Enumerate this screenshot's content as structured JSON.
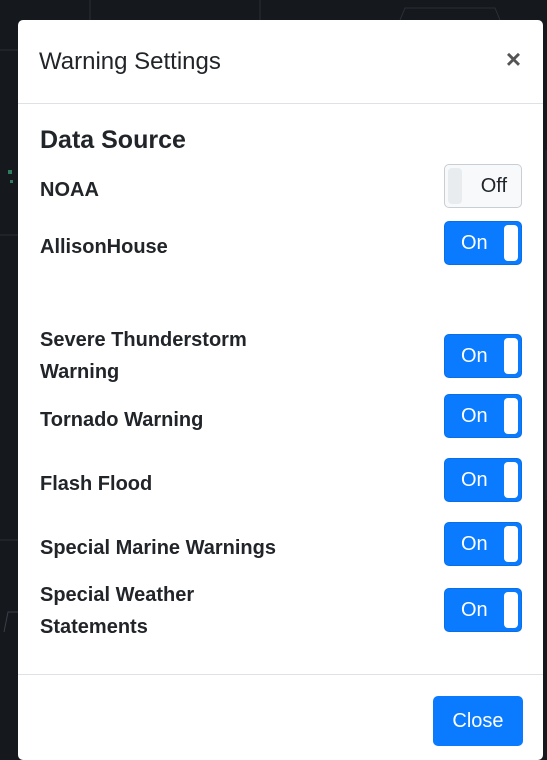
{
  "modal": {
    "title": "Warning Settings",
    "close_icon": "×",
    "close_button_label": "Close"
  },
  "data_source": {
    "title": "Data Source",
    "items": [
      {
        "label": "NOAA",
        "state": "Off"
      },
      {
        "label": "AllisonHouse",
        "state": "On"
      }
    ]
  },
  "warnings": {
    "items": [
      {
        "label": "Severe Thunderstorm Warning",
        "state": "On"
      },
      {
        "label": "Tornado Warning",
        "state": "On"
      },
      {
        "label": "Flash Flood",
        "state": "On"
      },
      {
        "label": "Special Marine Warnings",
        "state": "On"
      },
      {
        "label": "Special Weather Statements",
        "state": "On"
      }
    ]
  },
  "colors": {
    "accent": "#0a7bff",
    "backdrop": "#15181d"
  }
}
